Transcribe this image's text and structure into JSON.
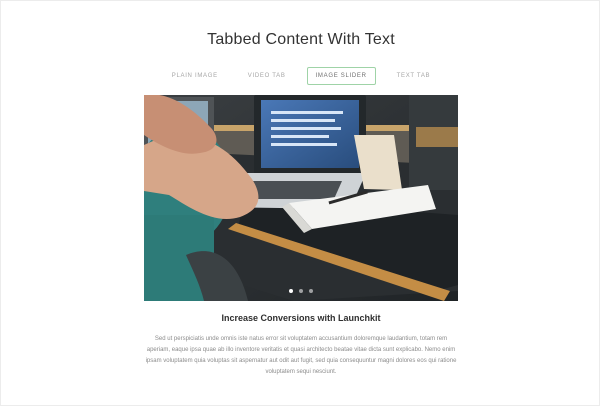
{
  "page": {
    "title": "Tabbed Content With Text"
  },
  "tabs": [
    {
      "label": "PLAIN IMAGE",
      "active": false
    },
    {
      "label": "VIDEO TAB",
      "active": false
    },
    {
      "label": "IMAGE SLIDER",
      "active": true
    },
    {
      "label": "TEXT TAB",
      "active": false
    }
  ],
  "slider": {
    "image_description": "laptop-and-notebook-photo",
    "dots": 3,
    "active_dot": 1
  },
  "content": {
    "heading": "Increase Conversions with Launchkit",
    "paragraph": "Sed ut perspiciatis unde omnis iste natus error sit voluptatem accusantium doloremque laudantium, totam rem aperiam, eaque ipsa quae ab illo inventore veritatis et quasi architecto beatae vitae dicta sunt explicabo. Nemo enim ipsam voluptatem quia voluptas sit aspernatur aut odit aut fugit, sed quia consequuntur magni dolores eos qui ratione voluptatem sequi nesciunt."
  },
  "colors": {
    "active_tab_border": "#9fd3a7",
    "heading": "#2f2f2f",
    "body": "#8c8c8c"
  }
}
